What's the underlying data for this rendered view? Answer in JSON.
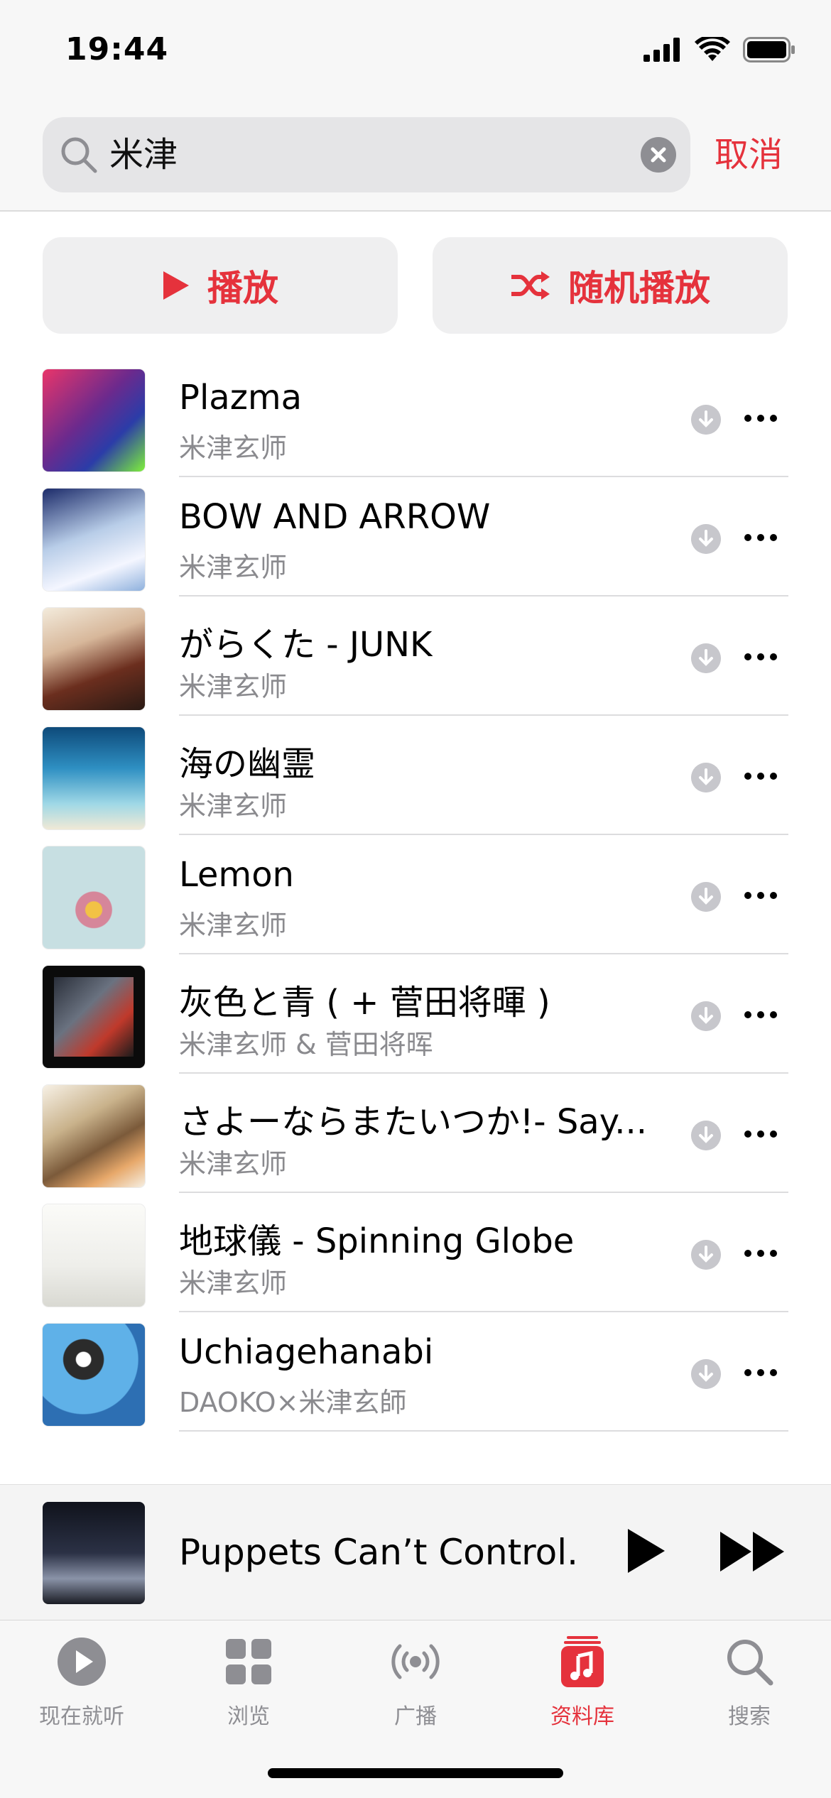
{
  "status_bar": {
    "time": "19:44"
  },
  "search": {
    "query": "米津",
    "cancel_label": "取消"
  },
  "actions": {
    "play_label": "播放",
    "shuffle_label": "随机播放"
  },
  "songs": [
    {
      "title": "Plazma",
      "artist": "米津玄师"
    },
    {
      "title": "BOW AND ARROW",
      "artist": "米津玄师"
    },
    {
      "title": "がらくた - JUNK",
      "artist": "米津玄师"
    },
    {
      "title": "海の幽霊",
      "artist": "米津玄师"
    },
    {
      "title": "Lemon",
      "artist": "米津玄师"
    },
    {
      "title": "灰色と青 ( + 菅田将暉 )",
      "artist": "米津玄师 & 菅田将晖"
    },
    {
      "title": "さよーならまたいつか!- Say...",
      "artist": "米津玄师"
    },
    {
      "title": "地球儀 - Spinning Globe",
      "artist": "米津玄师"
    },
    {
      "title": "Uchiagehanabi",
      "artist": "DAOKO×米津玄師"
    }
  ],
  "mini_player": {
    "title": "Puppets Can’t Control..."
  },
  "tabs": [
    {
      "label": "现在就听",
      "icon": "play-circle-icon"
    },
    {
      "label": "浏览",
      "icon": "grid-icon"
    },
    {
      "label": "广播",
      "icon": "radio-icon"
    },
    {
      "label": "资料库",
      "icon": "library-music-icon"
    },
    {
      "label": "搜索",
      "icon": "search-icon"
    }
  ],
  "colors": {
    "accent": "#e5323c",
    "secondary_text": "#8a8a8e",
    "inactive_tab": "#8e8e93"
  }
}
